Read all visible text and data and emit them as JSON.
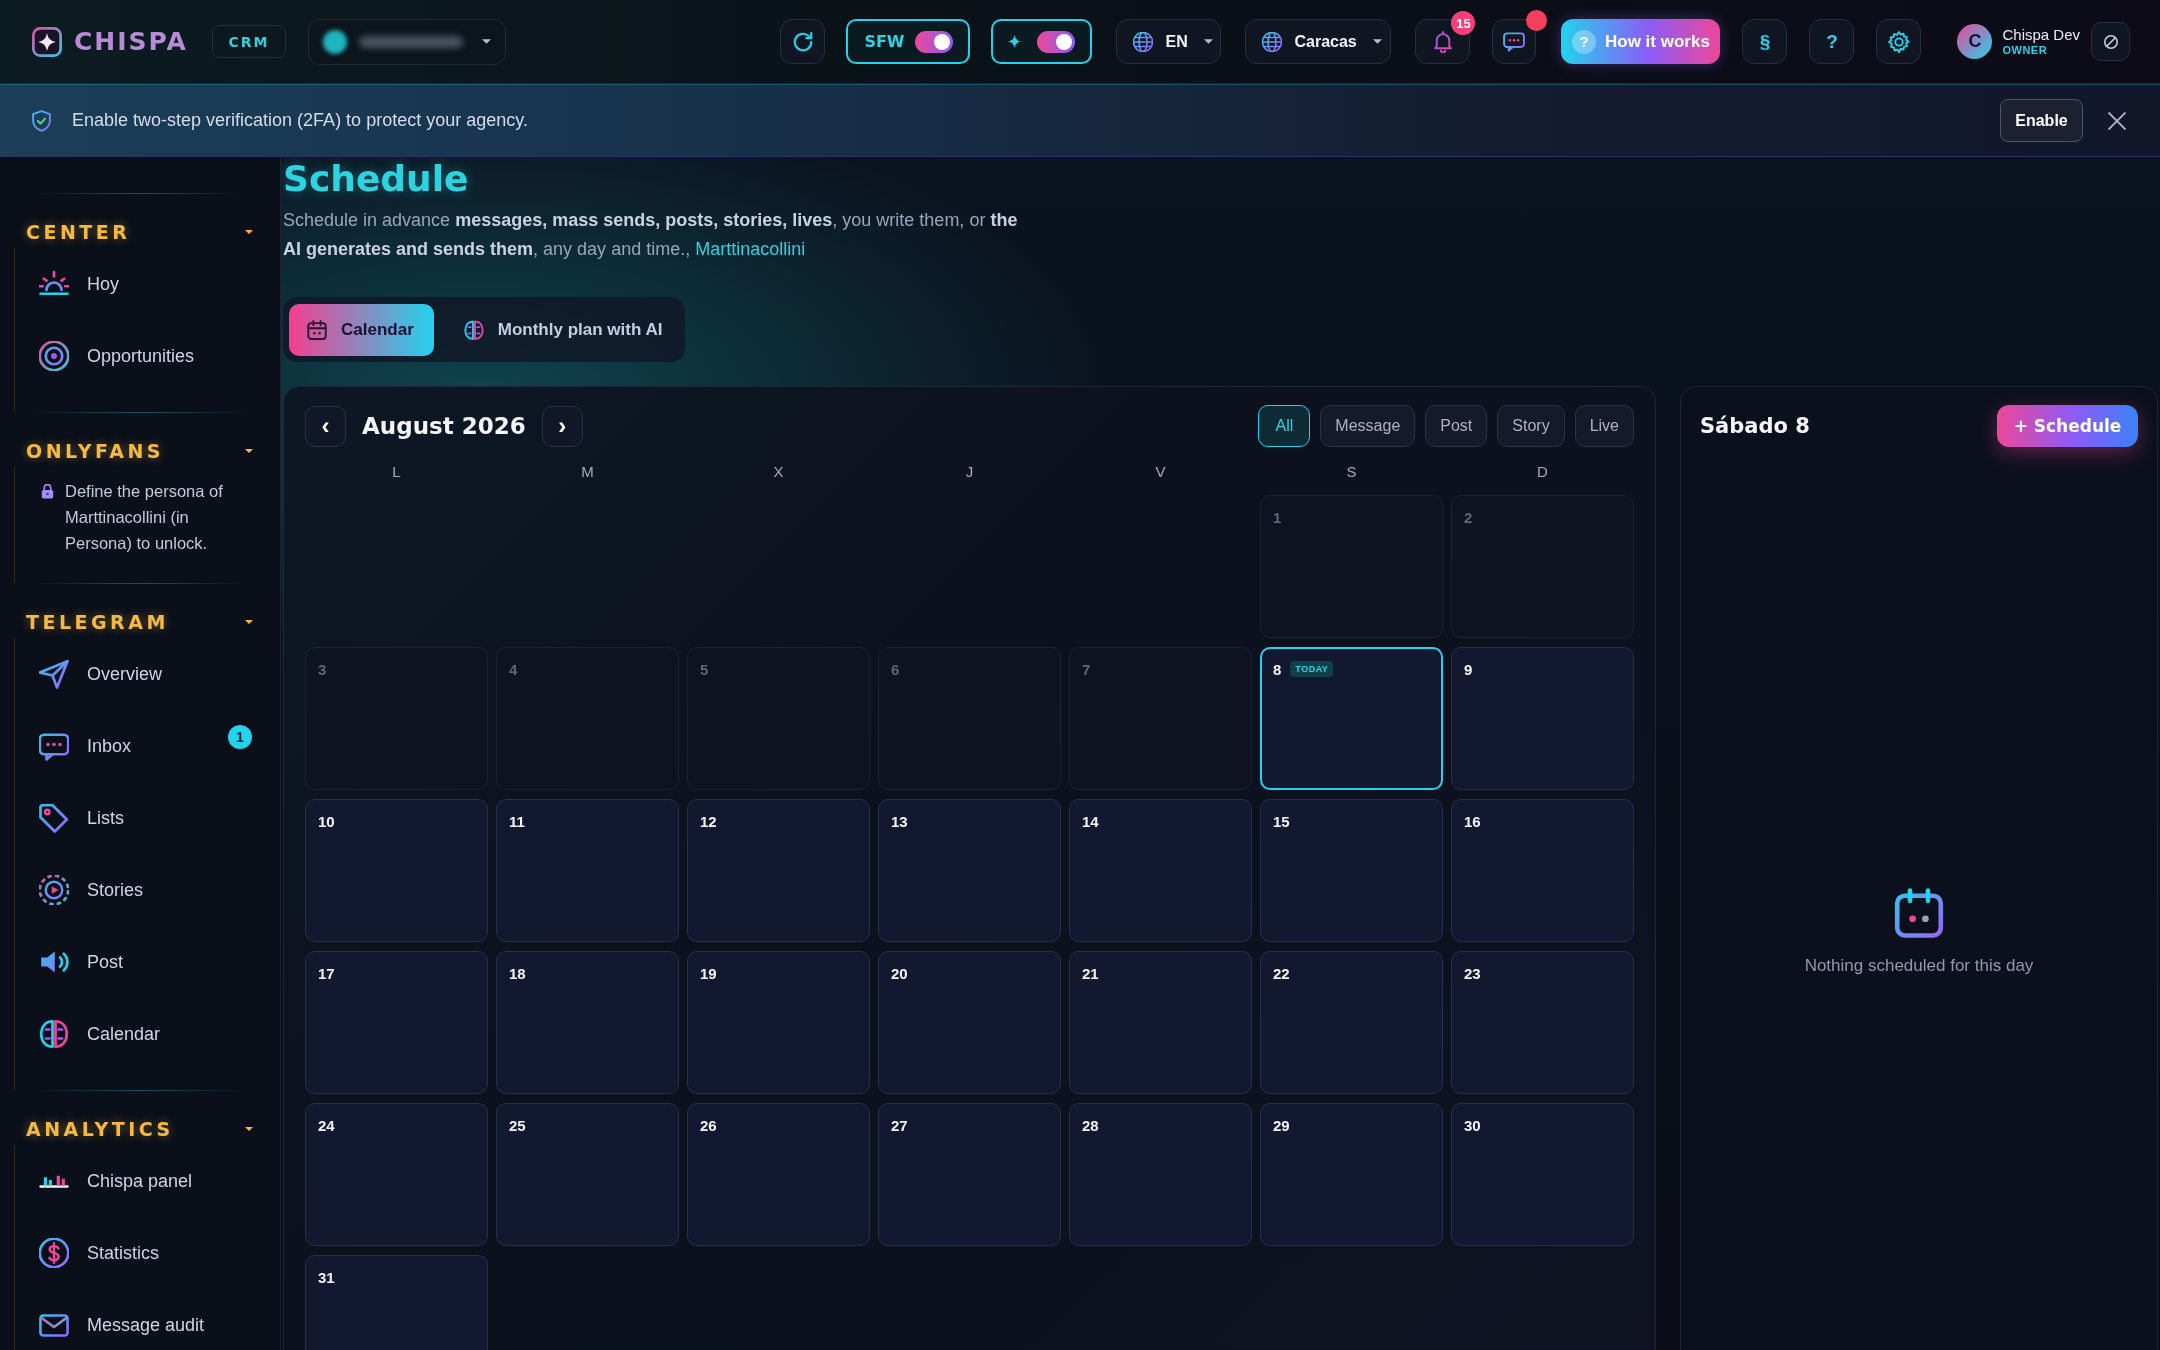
{
  "header": {
    "logo": "CHISPA",
    "badge": "CRM",
    "toggles": [
      {
        "kind": "label",
        "label": "SFW",
        "on": true
      },
      {
        "kind": "sparkle",
        "on": true
      }
    ],
    "language": "EN",
    "timezone": "Caracas",
    "notifications": "15",
    "messages_unread": true,
    "help": {
      "mark": "?",
      "label": "How it works"
    },
    "text_buttons": [
      "§",
      "?"
    ],
    "user": {
      "initial": "C",
      "name": "Chispa Dev",
      "role": "OWNER"
    }
  },
  "banner": {
    "text": "Enable two-step verification (2FA) to protect your agency.",
    "action": "Enable"
  },
  "sidebar": {
    "sections": [
      {
        "title": "CENTER",
        "expanded": true,
        "items": [
          {
            "label": "Hoy",
            "selected": false
          },
          {
            "label": "Opportunities",
            "selected": false
          }
        ]
      },
      {
        "title": "ONLYFANS",
        "expanded": true,
        "note": "Define the persona of Marttinacollini (in Persona) to unlock."
      },
      {
        "title": "TELEGRAM",
        "expanded": true,
        "items": [
          {
            "label": "Overview",
            "selected": false
          },
          {
            "label": "Inbox",
            "selected": false,
            "badge": "1"
          },
          {
            "label": "Lists",
            "selected": false
          },
          {
            "label": "Stories",
            "selected": false
          },
          {
            "label": "Post",
            "selected": false
          },
          {
            "label": "Calendar",
            "selected": false
          }
        ]
      },
      {
        "title": "ANALYTICS",
        "expanded": true,
        "items": [
          {
            "label": "Chispa panel",
            "selected": false
          },
          {
            "label": "Statistics",
            "selected": false
          },
          {
            "label": "Message audit",
            "selected": false
          }
        ]
      }
    ]
  },
  "page": {
    "title": "Schedule",
    "description": "Schedule in advance **messages, mass sends, posts, stories, lives**, you write them, or **the AI generates and sends them**, any day and time.,",
    "account": "Marttinacollini",
    "tabs": [
      {
        "label": "Calendar",
        "selected": true
      },
      {
        "label": "Monthly plan with AI",
        "selected": false
      }
    ]
  },
  "calendar": {
    "month": "August 2026",
    "prev": "‹",
    "next": "›",
    "filters": [
      {
        "label": "All",
        "selected": true
      },
      {
        "label": "Message",
        "selected": false
      },
      {
        "label": "Post",
        "selected": false
      },
      {
        "label": "Story",
        "selected": false
      },
      {
        "label": "Live",
        "selected": false
      }
    ],
    "weekdays": [
      "L",
      "M",
      "X",
      "J",
      "V",
      "S",
      "D"
    ],
    "cells": [
      {
        "kind": "blank"
      },
      {
        "kind": "blank"
      },
      {
        "kind": "blank"
      },
      {
        "kind": "blank"
      },
      {
        "kind": "blank"
      },
      {
        "kind": "day",
        "day": "1",
        "past": true,
        "today": false
      },
      {
        "kind": "day",
        "day": "2",
        "past": true,
        "today": false
      },
      {
        "kind": "day",
        "day": "3",
        "past": true,
        "today": false
      },
      {
        "kind": "day",
        "day": "4",
        "past": true,
        "today": false
      },
      {
        "kind": "day",
        "day": "5",
        "past": true,
        "today": false
      },
      {
        "kind": "day",
        "day": "6",
        "past": true,
        "today": false
      },
      {
        "kind": "day",
        "day": "7",
        "past": true,
        "today": false
      },
      {
        "kind": "day",
        "day": "8",
        "past": false,
        "today": true,
        "badge": "TODAY"
      },
      {
        "kind": "day",
        "day": "9",
        "past": false,
        "today": false
      },
      {
        "kind": "day",
        "day": "10",
        "past": false,
        "today": false
      },
      {
        "kind": "day",
        "day": "11",
        "past": false,
        "today": false
      },
      {
        "kind": "day",
        "day": "12",
        "past": false,
        "today": false
      },
      {
        "kind": "day",
        "day": "13",
        "past": false,
        "today": false
      },
      {
        "kind": "day",
        "day": "14",
        "past": false,
        "today": false
      },
      {
        "kind": "day",
        "day": "15",
        "past": false,
        "today": false
      },
      {
        "kind": "day",
        "day": "16",
        "past": false,
        "today": false
      },
      {
        "kind": "day",
        "day": "17",
        "past": false,
        "today": false
      },
      {
        "kind": "day",
        "day": "18",
        "past": false,
        "today": false
      },
      {
        "kind": "day",
        "day": "19",
        "past": false,
        "today": false
      },
      {
        "kind": "day",
        "day": "20",
        "past": false,
        "today": false
      },
      {
        "kind": "day",
        "day": "21",
        "past": false,
        "today": false
      },
      {
        "kind": "day",
        "day": "22",
        "past": false,
        "today": false
      },
      {
        "kind": "day",
        "day": "23",
        "past": false,
        "today": false
      },
      {
        "kind": "day",
        "day": "24",
        "past": false,
        "today": false
      },
      {
        "kind": "day",
        "day": "25",
        "past": false,
        "today": false
      },
      {
        "kind": "day",
        "day": "26",
        "past": false,
        "today": false
      },
      {
        "kind": "day",
        "day": "27",
        "past": false,
        "today": false
      },
      {
        "kind": "day",
        "day": "28",
        "past": false,
        "today": false
      },
      {
        "kind": "day",
        "day": "29",
        "past": false,
        "today": false
      },
      {
        "kind": "day",
        "day": "30",
        "past": false,
        "today": false
      },
      {
        "kind": "day",
        "day": "31",
        "past": false,
        "today": false
      }
    ]
  },
  "day_panel": {
    "title": "Sábado 8",
    "action": "+ Schedule",
    "empty_text": "Nothing scheduled for this day"
  }
}
